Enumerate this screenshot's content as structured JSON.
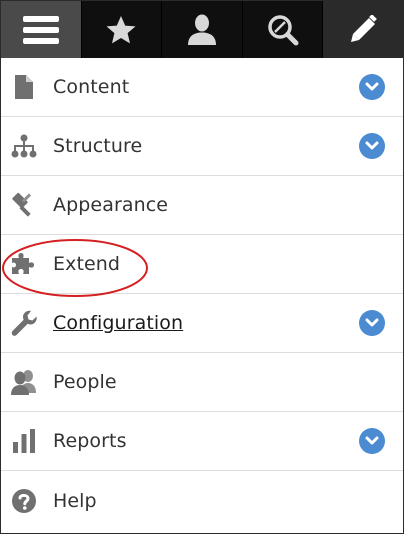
{
  "toolbar": {
    "items": [
      {
        "icon": "hamburger-menu-icon",
        "state": "active"
      },
      {
        "icon": "star-icon"
      },
      {
        "icon": "user-icon"
      },
      {
        "icon": "search-icon"
      },
      {
        "icon": "pencil-icon",
        "state": "edit"
      }
    ]
  },
  "menu": {
    "items": [
      {
        "label": "Content",
        "icon": "file-icon",
        "expandable": true
      },
      {
        "label": "Structure",
        "icon": "hierarchy-icon",
        "expandable": true
      },
      {
        "label": "Appearance",
        "icon": "paint-roller-icon",
        "expandable": false
      },
      {
        "label": "Extend",
        "icon": "puzzle-piece-icon",
        "expandable": false,
        "highlighted": true
      },
      {
        "label": "Configuration",
        "icon": "wrench-icon",
        "expandable": true,
        "underlined": true
      },
      {
        "label": "People",
        "icon": "people-icon",
        "expandable": false
      },
      {
        "label": "Reports",
        "icon": "bar-chart-icon",
        "expandable": true
      },
      {
        "label": "Help",
        "icon": "question-circle-icon",
        "expandable": false
      }
    ]
  },
  "colors": {
    "toolbar_bg": "#0f0f0f",
    "toolbar_active": "#4a4a4a",
    "icon_gray": "#6f6f6f",
    "expand_blue": "#4a8bd1",
    "annotation_red": "#d42020"
  }
}
